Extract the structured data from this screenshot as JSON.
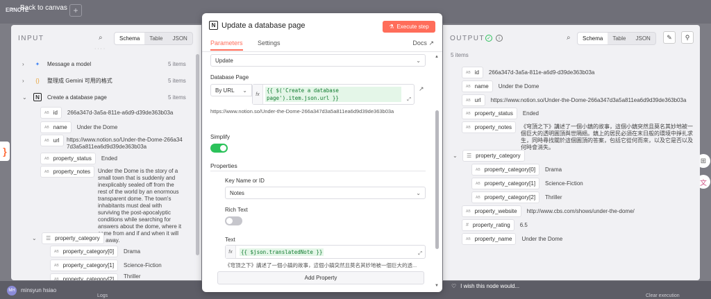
{
  "app": {
    "back_label": "Back to canvas",
    "logo_text": "ERNOTE"
  },
  "user": {
    "initials": "MH",
    "name": "minsyun hsiao"
  },
  "bottom": {
    "logs": "Logs",
    "clear": "Clear execution"
  },
  "wish": "I wish this node would...",
  "input": {
    "title": "INPUT",
    "tabs": [
      "Schema",
      "Table",
      "JSON"
    ],
    "active_tab": "Schema",
    "nodes": [
      {
        "label": "Message a model",
        "count": "5 items"
      },
      {
        "label": "整理成 Gemini 可用的格式",
        "count": "5 items"
      },
      {
        "label": "Create a database page",
        "count": "5 items"
      }
    ],
    "fields": [
      {
        "type": "AB",
        "key": "id",
        "value": "266a347d-3a5a-811e-a6d9-d39de363b03a"
      },
      {
        "type": "AB",
        "key": "name",
        "value": "Under the Dome"
      },
      {
        "type": "AB",
        "key": "url",
        "value": "https://www.notion.so/Under-the-Dome-266a347d3a5a811ea6d9d39de363b03a"
      },
      {
        "type": "AB",
        "key": "property_status",
        "value": "Ended"
      },
      {
        "type": "AB",
        "key": "property_notes",
        "value": "Under the Dome is the story of a small town that is suddenly and inexplicably sealed off from the rest of the world by an enormous transparent dome. The town's inhabitants must deal with surviving the post-apocalyptic conditions while searching for answers about the dome, where it came from and if and when it will go away."
      }
    ],
    "category": {
      "key": "property_category",
      "items": [
        {
          "type": "AB",
          "key": "property_category[0]",
          "value": "Drama"
        },
        {
          "type": "AB",
          "key": "property_category[1]",
          "value": "Science-Fiction"
        },
        {
          "type": "AB",
          "key": "property_category[2]",
          "value": "Thriller"
        }
      ]
    }
  },
  "modal": {
    "title": "Update a database page",
    "execute_label": "Execute step",
    "tabs": {
      "parameters": "Parameters",
      "settings": "Settings",
      "docs": "Docs"
    },
    "operation_value": "Update",
    "database_page_label": "Database Page",
    "by_url": "By URL",
    "db_expr": "{{ $('Create a database page').item.json.url }}",
    "db_preview": "https://www.notion.so/Under-the-Dome-266a347d3a5a811ea6d9d39de363b03a",
    "simplify_label": "Simplify",
    "simplify_on": true,
    "properties_label": "Properties",
    "key_name_label": "Key Name or ID",
    "key_name_value": "Notes",
    "rich_text_label": "Rich Text",
    "rich_text_on": false,
    "text_label": "Text",
    "text_expr": "{{ $json.translatedNote }}",
    "text_preview": "《穹頂之下》講述了一個小鎮的故事，這個小鎮突然且莫名其妙地被一個巨大的透...",
    "add_property": "Add Property"
  },
  "output": {
    "title": "OUTPUT",
    "count": "5 items",
    "tabs": [
      "Schema",
      "Table",
      "JSON"
    ],
    "active_tab": "Schema",
    "fields": [
      {
        "type": "AB",
        "key": "id",
        "value": "266a347d-3a5a-811e-a6d9-d39de363b03a"
      },
      {
        "type": "AB",
        "key": "name",
        "value": "Under the Dome"
      },
      {
        "type": "AB",
        "key": "url",
        "value": "https://www.notion.so/Under-the-Dome-266a347d3a5a811ea6d9d39de363b03a"
      },
      {
        "type": "AB",
        "key": "property_status",
        "value": "Ended"
      },
      {
        "type": "AB",
        "key": "property_notes",
        "value": "《穹頂之下》講述了一個小鎮的故事，這個小鎮突然且莫名其妙地被一個巨大的透明圓頂與世隔絕。鎮上的居民必須在末日般的環境中掙扎求生，同時尋找關於這個圓頂的答案，包括它從何而來，以及它是否以及何時會消失。"
      }
    ],
    "category": {
      "key": "property_category",
      "items": [
        {
          "type": "AB",
          "key": "property_category[0]",
          "value": "Drama"
        },
        {
          "type": "AB",
          "key": "property_category[1]",
          "value": "Science-Fiction"
        },
        {
          "type": "AB",
          "key": "property_category[2]",
          "value": "Thriller"
        }
      ]
    },
    "extra": [
      {
        "type": "AB",
        "key": "property_website",
        "value": "http://www.cbs.com/shows/under-the-dome/"
      },
      {
        "type": "#",
        "key": "property_rating",
        "value": "6.5"
      },
      {
        "type": "AB",
        "key": "property_name",
        "value": "Under the Dome"
      }
    ]
  },
  "colors": {
    "accent": "#ff6d5a",
    "success": "#2bc25a"
  }
}
